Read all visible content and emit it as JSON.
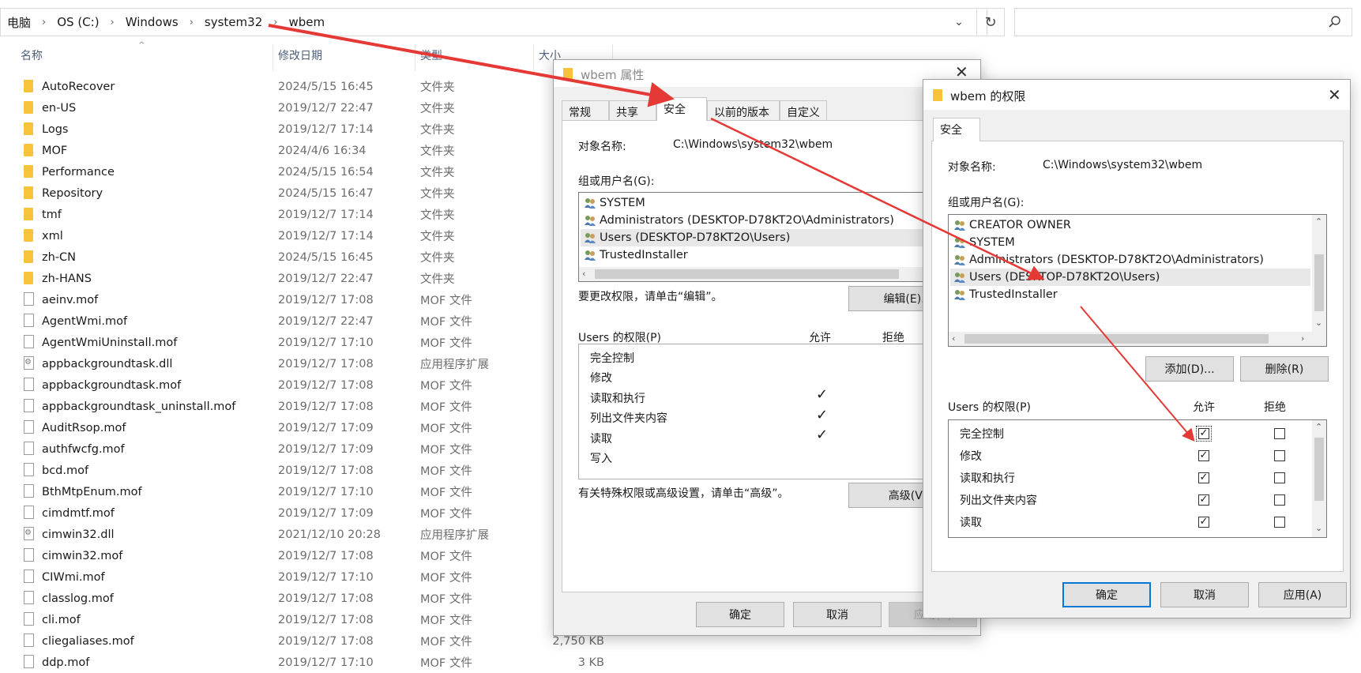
{
  "explorer": {
    "breadcrumb": [
      "电脑",
      "OS (C:)",
      "Windows",
      "system32",
      "wbem"
    ],
    "columns": {
      "name": "名称",
      "date": "修改日期",
      "type": "类型",
      "size": "大小"
    },
    "files": [
      {
        "name": "AutoRecover",
        "date": "2024/5/15 16:45",
        "type": "文件夹",
        "size": "",
        "kind": "folder"
      },
      {
        "name": "en-US",
        "date": "2019/12/7 22:47",
        "type": "文件夹",
        "size": "",
        "kind": "folder"
      },
      {
        "name": "Logs",
        "date": "2019/12/7 17:14",
        "type": "文件夹",
        "size": "",
        "kind": "folder"
      },
      {
        "name": "MOF",
        "date": "2024/4/6 16:34",
        "type": "文件夹",
        "size": "",
        "kind": "folder"
      },
      {
        "name": "Performance",
        "date": "2024/5/15 16:54",
        "type": "文件夹",
        "size": "",
        "kind": "folder"
      },
      {
        "name": "Repository",
        "date": "2024/5/15 16:47",
        "type": "文件夹",
        "size": "",
        "kind": "folder"
      },
      {
        "name": "tmf",
        "date": "2019/12/7 17:14",
        "type": "文件夹",
        "size": "",
        "kind": "folder"
      },
      {
        "name": "xml",
        "date": "2019/12/7 17:14",
        "type": "文件夹",
        "size": "",
        "kind": "folder"
      },
      {
        "name": "zh-CN",
        "date": "2024/5/15 16:45",
        "type": "文件夹",
        "size": "",
        "kind": "folder"
      },
      {
        "name": "zh-HANS",
        "date": "2019/12/7 22:47",
        "type": "文件夹",
        "size": "",
        "kind": "folder"
      },
      {
        "name": "aeinv.mof",
        "date": "2019/12/7 17:08",
        "type": "MOF 文件",
        "size": "",
        "kind": "file"
      },
      {
        "name": "AgentWmi.mof",
        "date": "2019/12/7 22:47",
        "type": "MOF 文件",
        "size": "",
        "kind": "file"
      },
      {
        "name": "AgentWmiUninstall.mof",
        "date": "2019/12/7 17:10",
        "type": "MOF 文件",
        "size": "",
        "kind": "file"
      },
      {
        "name": "appbackgroundtask.dll",
        "date": "2019/12/7 17:08",
        "type": "应用程序扩展",
        "size": "",
        "kind": "dll"
      },
      {
        "name": "appbackgroundtask.mof",
        "date": "2019/12/7 17:08",
        "type": "MOF 文件",
        "size": "",
        "kind": "file"
      },
      {
        "name": "appbackgroundtask_uninstall.mof",
        "date": "2019/12/7 17:08",
        "type": "MOF 文件",
        "size": "",
        "kind": "file"
      },
      {
        "name": "AuditRsop.mof",
        "date": "2019/12/7 17:09",
        "type": "MOF 文件",
        "size": "",
        "kind": "file"
      },
      {
        "name": "authfwcfg.mof",
        "date": "2019/12/7 17:09",
        "type": "MOF 文件",
        "size": "",
        "kind": "file"
      },
      {
        "name": "bcd.mof",
        "date": "2019/12/7 17:08",
        "type": "MOF 文件",
        "size": "",
        "kind": "file"
      },
      {
        "name": "BthMtpEnum.mof",
        "date": "2019/12/7 17:10",
        "type": "MOF 文件",
        "size": "",
        "kind": "file"
      },
      {
        "name": "cimdmtf.mof",
        "date": "2019/12/7 17:09",
        "type": "MOF 文件",
        "size": "",
        "kind": "file"
      },
      {
        "name": "cimwin32.dll",
        "date": "2021/12/10 20:28",
        "type": "应用程序扩展",
        "size": "",
        "kind": "dll"
      },
      {
        "name": "cimwin32.mof",
        "date": "2019/12/7 17:08",
        "type": "MOF 文件",
        "size": "",
        "kind": "file"
      },
      {
        "name": "CIWmi.mof",
        "date": "2019/12/7 17:10",
        "type": "MOF 文件",
        "size": "",
        "kind": "file"
      },
      {
        "name": "classlog.mof",
        "date": "2019/12/7 17:08",
        "type": "MOF 文件",
        "size": "",
        "kind": "file"
      },
      {
        "name": "cli.mof",
        "date": "2019/12/7 17:08",
        "type": "MOF 文件",
        "size": "",
        "kind": "file"
      },
      {
        "name": "cliegaliases.mof",
        "date": "2019/12/7 17:08",
        "type": "MOF 文件",
        "size": "2,750 KB",
        "kind": "file"
      },
      {
        "name": "ddp.mof",
        "date": "2019/12/7 17:10",
        "type": "MOF 文件",
        "size": "3 KB",
        "kind": "file"
      }
    ]
  },
  "props": {
    "title": "wbem 属性",
    "tabs": [
      "常规",
      "共享",
      "安全",
      "以前的版本",
      "自定义"
    ],
    "object_label": "对象名称:",
    "object_value": "C:\\Windows\\system32\\wbem",
    "group_label": "组或用户名(G):",
    "groups": [
      "SYSTEM",
      "Administrators (DESKTOP-D78KT2O\\Administrators)",
      "Users (DESKTOP-D78KT2O\\Users)",
      "TrustedInstaller"
    ],
    "edit_hint": "要更改权限，请单击“编辑”。",
    "edit_btn": "编辑(E)...",
    "perm_label": "Users 的权限(P)",
    "allow": "允许",
    "deny": "拒绝",
    "perms": [
      "完全控制",
      "修改",
      "读取和执行",
      "列出文件夹内容",
      "读取",
      "写入"
    ],
    "adv_hint": "有关特殊权限或高级设置，请单击“高级”。",
    "adv_btn": "高级(V)",
    "ok": "确定",
    "cancel": "取消",
    "apply": "应用(A)"
  },
  "perm": {
    "title": "wbem 的权限",
    "tab": "安全",
    "object_label": "对象名称:",
    "object_value": "C:\\Windows\\system32\\wbem",
    "group_label": "组或用户名(G):",
    "groups": [
      "CREATOR OWNER",
      "SYSTEM",
      "Administrators (DESKTOP-D78KT2O\\Administrators)",
      "Users (DESKTOP-D78KT2O\\Users)",
      "TrustedInstaller"
    ],
    "add_btn": "添加(D)...",
    "remove_btn": "删除(R)",
    "perm_label": "Users 的权限(P)",
    "allow": "允许",
    "deny": "拒绝",
    "perms": [
      "完全控制",
      "修改",
      "读取和执行",
      "列出文件夹内容",
      "读取"
    ],
    "ok": "确定",
    "cancel": "取消",
    "apply": "应用(A)"
  },
  "colors": {
    "accent": "#0078d7",
    "arrow": "#e53935",
    "folder": "#f6c33b"
  }
}
